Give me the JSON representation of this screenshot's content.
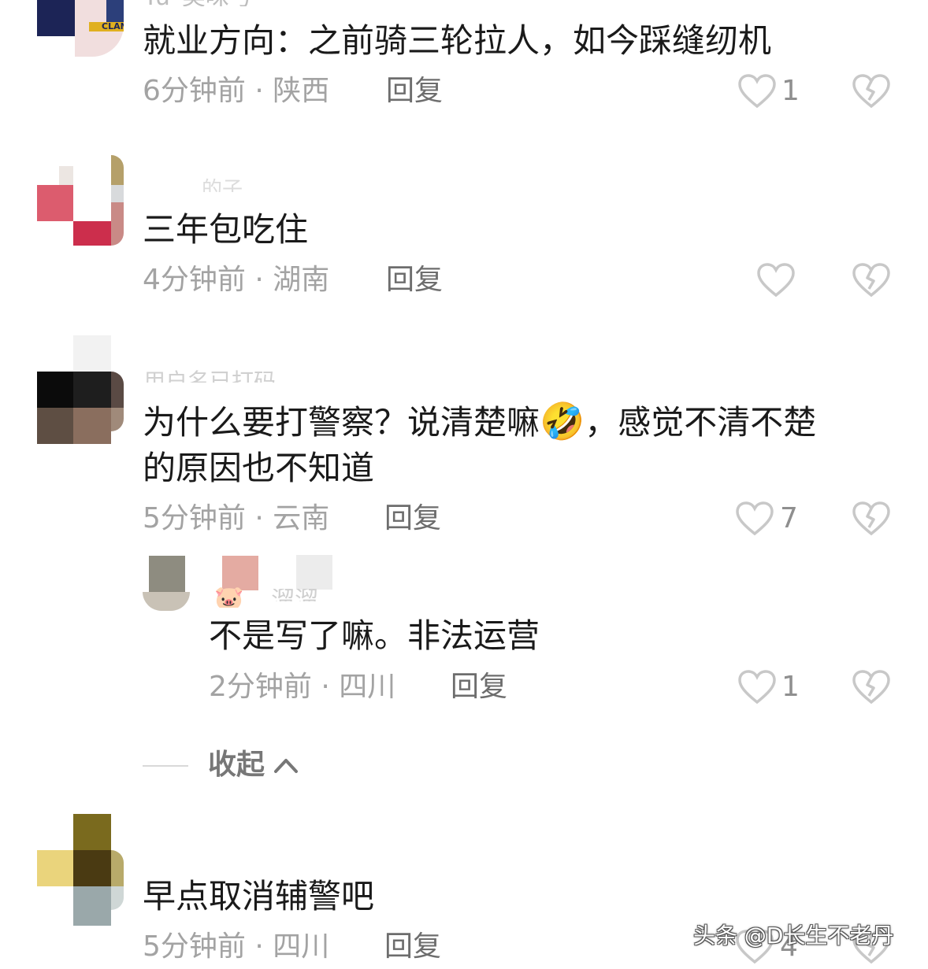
{
  "comments": [
    {
      "username": "Yu_美味号",
      "text": "就业方向：之前骑三轮拉人，如今踩缝纫机",
      "time": "6分钟前",
      "location": "陕西",
      "reply_label": "回复",
      "likes": "1",
      "avatar_badge": "CLAN"
    },
    {
      "username": "…的子",
      "text": "三年包吃住",
      "time": "4分钟前",
      "location": "湖南",
      "reply_label": "回复",
      "likes": ""
    },
    {
      "username": "用户名已打码",
      "text_line1": "为什么要打警察？说清楚嘛",
      "emoji": "🤣",
      "text_line1_end": "，感觉不清不楚",
      "text_line2": "的原因也不知道",
      "time": "5分钟前",
      "location": "云南",
      "reply_label": "回复",
      "likes": "7"
    },
    {
      "username": "…",
      "text": "早点取消辅警吧",
      "time": "5分钟前",
      "location": "四川",
      "reply_label": "回复",
      "likes": "4"
    }
  ],
  "reply": {
    "username": "溜溜",
    "text": "不是写了嘛。非法运营",
    "time": "2分钟前",
    "location": "四川",
    "reply_label": "回复",
    "likes": "1",
    "avatar_emoji": "🐷"
  },
  "collapse": {
    "label": "收起"
  },
  "watermark": "头条 @D长生不老丹",
  "colors": {
    "heart": "#c8c8c8",
    "text": "#1a1a1a",
    "meta": "#a3a3a3"
  },
  "icons": {
    "like": "heart-outline-icon",
    "dislike": "broken-heart-icon",
    "collapse": "chevron-up-icon"
  }
}
